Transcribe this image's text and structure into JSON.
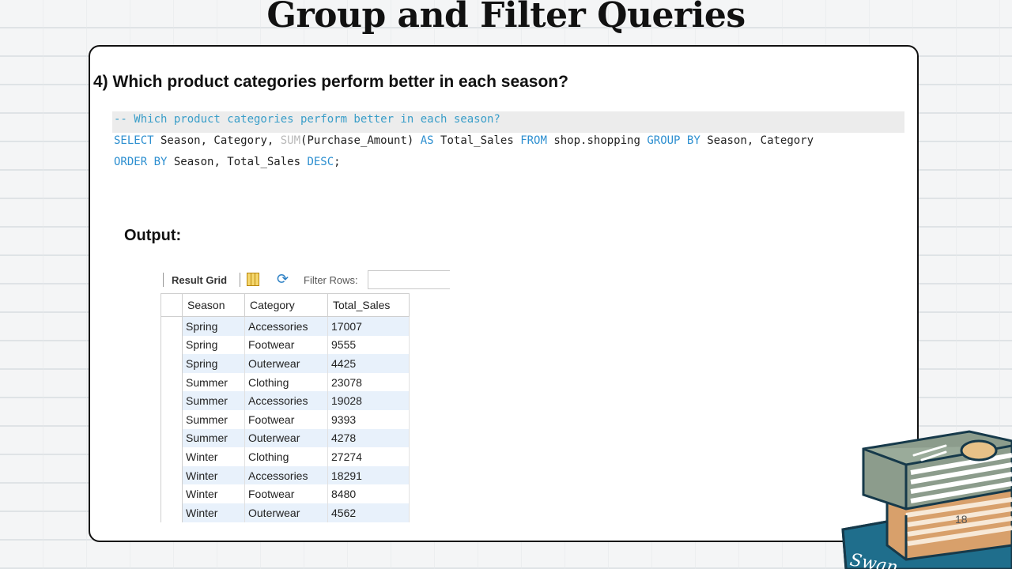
{
  "slide": {
    "title": "Group and Filter Queries",
    "question": "4) Which product categories perform better in each season?",
    "output_label": "Output:",
    "page_number": "18"
  },
  "sql": {
    "comment": "-- Which product categories perform better in each season?",
    "line1": {
      "select": "SELECT",
      "cols": " Season, Category, ",
      "sum": "SUM",
      "arg": "(Purchase_Amount) ",
      "as": "AS",
      "alias": " Total_Sales ",
      "from": "FROM",
      "table": " shop.shopping ",
      "group_by": "GROUP BY",
      "group_cols": " Season, Category"
    },
    "line2": {
      "order_by": "ORDER BY",
      "order_cols": " Season, Total_Sales ",
      "desc": "DESC",
      "semicolon": ";"
    }
  },
  "result_grid": {
    "label": "Result Grid",
    "filter_label": "Filter Rows:",
    "filter_value": "",
    "columns": [
      "Season",
      "Category",
      "Total_Sales"
    ],
    "rows": [
      [
        "Spring",
        "Accessories",
        "17007"
      ],
      [
        "Spring",
        "Footwear",
        "9555"
      ],
      [
        "Spring",
        "Outerwear",
        "4425"
      ],
      [
        "Summer",
        "Clothing",
        "23078"
      ],
      [
        "Summer",
        "Accessories",
        "19028"
      ],
      [
        "Summer",
        "Footwear",
        "9393"
      ],
      [
        "Summer",
        "Outerwear",
        "4278"
      ],
      [
        "Winter",
        "Clothing",
        "27274"
      ],
      [
        "Winter",
        "Accessories",
        "18291"
      ],
      [
        "Winter",
        "Footwear",
        "8480"
      ],
      [
        "Winter",
        "Outerwear",
        "4562"
      ]
    ]
  },
  "decor": {
    "book_spine_text": "Swan",
    "colors": {
      "keyword": "#2d8fd0",
      "comment": "#3a9ec9",
      "row_alt": "#e8f1fb"
    },
    "icons": [
      "grid-icon",
      "refresh-icon",
      "books-illustration"
    ]
  }
}
